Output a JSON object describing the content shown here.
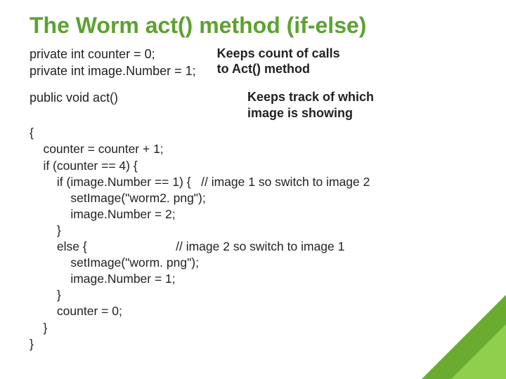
{
  "title": "The Worm act() method (if-else)",
  "decl": {
    "line1": "private int counter = 0;",
    "line2": "private int image.Number = 1;"
  },
  "annot1": {
    "line1": "Keeps count of calls",
    "line2": "to Act() method"
  },
  "method_sig": "public void act()",
  "annot2": {
    "line1": "Keeps track of which",
    "line2": "image is showing"
  },
  "code": "{\n    counter = counter + 1;\n    if (counter == 4) {\n        if (image.Number == 1) {   // image 1 so switch to image 2\n            setImage(\"worm2. png\");\n            image.Number = 2;\n        }\n        else {                          // image 2 so switch to image 1\n            setImage(\"worm. png\");\n            image.Number = 1;\n        }\n        counter = 0;\n    }\n}"
}
